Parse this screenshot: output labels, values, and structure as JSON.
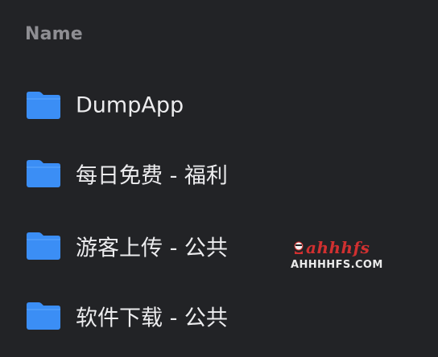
{
  "header": {
    "name_column_label": "Name"
  },
  "files": [
    {
      "icon": "folder-icon",
      "name": "DumpApp"
    },
    {
      "icon": "folder-icon",
      "name": "每日免费 - 福利"
    },
    {
      "icon": "folder-icon",
      "name": "游客上传 - 公共"
    },
    {
      "icon": "folder-icon",
      "name": "软件下载 - 公共"
    }
  ],
  "watermark": {
    "logo_text": "ahhhfs",
    "site_text": "AHHHHFS.COM"
  },
  "colors": {
    "background": "#222326",
    "folder_blue": "#3b8ef5",
    "header_text": "#8e8e93",
    "item_text": "#ececee"
  }
}
